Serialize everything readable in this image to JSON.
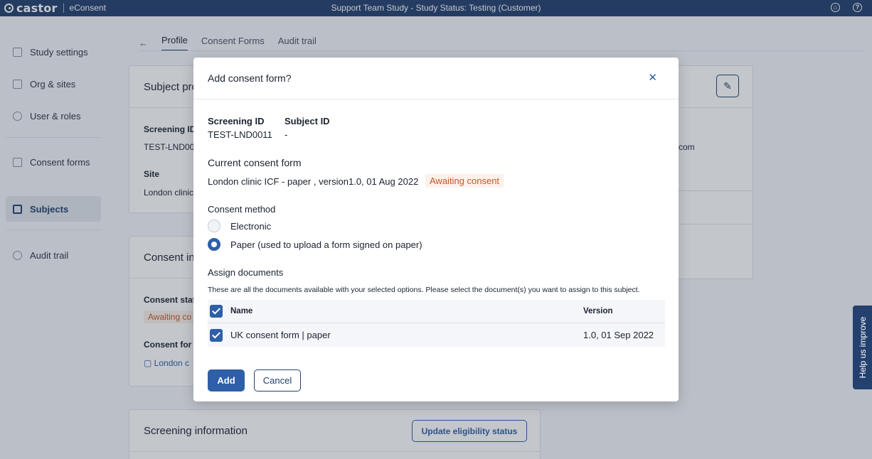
{
  "app": {
    "logo": "castor",
    "product": "eConsent",
    "title": "Support Team Study  - Study Status: Testing (Customer)"
  },
  "header_icons": [
    "account-icon",
    "help-icon"
  ],
  "sidebar": {
    "items": [
      {
        "label": "Study settings",
        "icon": "folder-icon"
      },
      {
        "label": "Org & sites",
        "icon": "building-icon"
      },
      {
        "label": "User & roles",
        "icon": "users-icon"
      },
      {
        "label": "Consent forms",
        "icon": "clipboard-icon"
      },
      {
        "label": "Subjects",
        "icon": "subjects-icon",
        "active": true
      },
      {
        "label": "Audit trail",
        "icon": "history-icon"
      }
    ]
  },
  "main": {
    "tabs": [
      "Profile",
      "Consent Forms",
      "Audit trail"
    ],
    "subject_card": {
      "title": "Subject pro",
      "screening_label": "Screening ID",
      "screening_value": "TEST-LND00",
      "site_label": "Site",
      "site_value": "London clinic",
      "email_fragment": "com"
    },
    "consent_card": {
      "title": "Consent in",
      "status_label": "Consent stat",
      "status_value": "Awaiting co",
      "form_label": "Consent for",
      "form_value": "London c"
    },
    "screening_card": {
      "title": "Screening information",
      "button": "Update eligibility status"
    }
  },
  "help_tab": "Help us improve",
  "modal": {
    "title": "Add consent form?",
    "screening_id_label": "Screening ID",
    "screening_id_value": "TEST-LND0011",
    "subject_id_label": "Subject ID",
    "subject_id_value": "-",
    "current_form_heading": "Current consent form",
    "current_form_text": "London clinic ICF - paper , version1.0, 01 Aug 2022",
    "current_form_status": "Awaiting consent",
    "method_heading": "Consent method",
    "methods": [
      {
        "label": "Electronic",
        "selected": false
      },
      {
        "label": "Paper (used to upload a form signed on paper)",
        "selected": true
      }
    ],
    "assign_heading": "Assign documents",
    "assign_hint": "These are all the documents available with your selected options. Please select the document(s) you want to assign to this subject.",
    "table": {
      "columns": [
        "Name",
        "Version"
      ],
      "rows": [
        {
          "name": "UK consent form | paper",
          "version": "1.0, 01 Sep 2022",
          "checked": true
        }
      ]
    },
    "add_button": "Add",
    "cancel_button": "Cancel"
  },
  "colors": {
    "brand": "#23406e",
    "accent": "#2e5fa8",
    "warning": "#c35a2a"
  }
}
